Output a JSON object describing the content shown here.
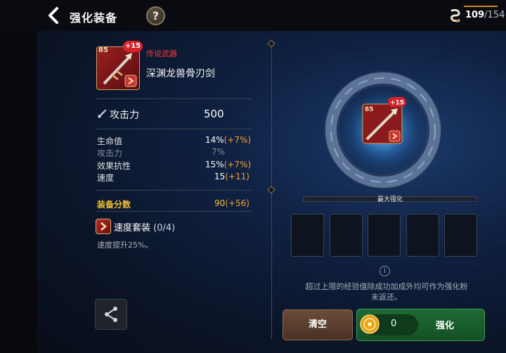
{
  "header": {
    "title": "强化装备",
    "help_label": "?",
    "stamina_current": "109",
    "stamina_max": "/154"
  },
  "item": {
    "level": "85",
    "enhance_badge": "+15",
    "rarity": "传说武器",
    "name": "深渊龙兽骨刃剑"
  },
  "main_stat": {
    "label": "攻击力",
    "value": "500"
  },
  "sub_stats": [
    {
      "label": "生命值",
      "value": "14%",
      "bonus": "(+7%)"
    },
    {
      "label": "攻击力",
      "value": "7%",
      "bonus": ""
    },
    {
      "label": "效果抗性",
      "value": "15%",
      "bonus": "(+7%)"
    },
    {
      "label": "速度",
      "value": "15",
      "bonus": "(+11)"
    }
  ],
  "score": {
    "label": "装备分数",
    "value": "90",
    "bonus": "(+56)"
  },
  "set": {
    "name": "速度套装",
    "count": "(0/4)",
    "description": "速度提升25%。"
  },
  "enhance_panel": {
    "max_label": "最大强化",
    "slot_count": 5,
    "notice_line1": "超过上限的经验值除成功加成外均可作为强化粉",
    "notice_line2": "末返还。",
    "clear_label": "清空",
    "cost": "0",
    "enhance_label": "强化"
  },
  "colors": {
    "rarity": "#e63b3b",
    "bonus": "#f0a030",
    "score": "#f2c232",
    "enhance_button": "#1f6a34",
    "clear_button": "#6b4c3a"
  },
  "icons": [
    "back-arrow-icon",
    "help-icon",
    "stamina-icon",
    "sword-icon",
    "set-icon",
    "share-icon",
    "info-icon",
    "gold-coin-icon"
  ]
}
